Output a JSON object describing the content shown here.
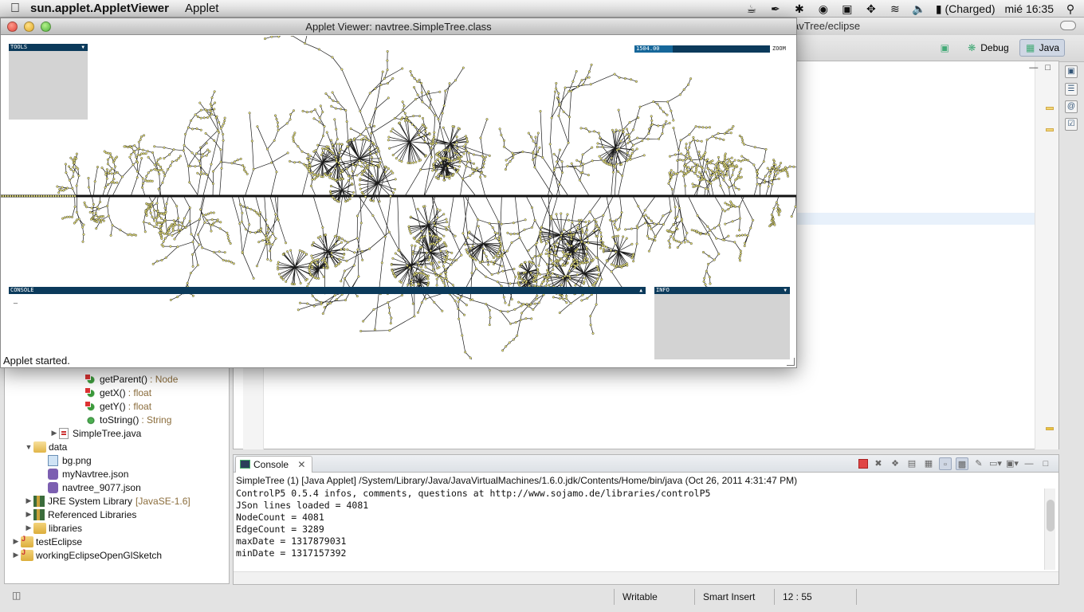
{
  "menubar": {
    "app_name": "sun.applet.AppletViewer",
    "menus": [
      "Applet"
    ],
    "battery": "(Charged)",
    "clock": "mié 16:35"
  },
  "eclipse": {
    "title_fragment": "avTree/eclipse",
    "perspectives": {
      "debug": "Debug",
      "java": "Java"
    }
  },
  "package_explorer": {
    "rows": [
      {
        "label": "getParent()",
        "type": ": Node",
        "icon": "method-icon"
      },
      {
        "label": "getX()",
        "type": ": float",
        "icon": "method-icon"
      },
      {
        "label": "getY()",
        "type": ": float",
        "icon": "method-icon"
      },
      {
        "label": "toString()",
        "type": ": String",
        "icon": "public-method-icon"
      },
      {
        "label": "SimpleTree.java",
        "type": "",
        "icon": "java-file-icon"
      },
      {
        "label": "data",
        "type": "",
        "icon": "folder-icon"
      },
      {
        "label": "bg.png",
        "type": "",
        "icon": "image-file-icon"
      },
      {
        "label": "myNavtree.json",
        "type": "",
        "icon": "json-file-icon"
      },
      {
        "label": "navtree_9077.json",
        "type": "",
        "icon": "json-file-icon"
      },
      {
        "label": "JRE System Library",
        "type": "[JavaSE-1.6]",
        "icon": "library-icon"
      },
      {
        "label": "Referenced Libraries",
        "type": "",
        "icon": "library-icon"
      },
      {
        "label": "libraries",
        "type": "",
        "icon": "folder-icon"
      },
      {
        "label": "testEclipse",
        "type": "",
        "icon": "java-project-icon"
      },
      {
        "label": "workingEclipseOpenGlSketch",
        "type": "",
        "icon": "java-project-icon"
      }
    ]
  },
  "console": {
    "tab_label": "Console",
    "description": "SimpleTree (1) [Java Applet] /System/Library/Java/JavaVirtualMachines/1.6.0.jdk/Contents/Home/bin/java (Oct 26, 2011 4:31:47 PM)",
    "lines": [
      "ControlP5 0.5.4 infos, comments, questions at http://www.sojamo.de/libraries/controlP5",
      "JSon lines loaded = 4081",
      "NodeCount = 4081",
      "EdgeCount = 3289",
      "maxDate = 1317879031",
      "minDate = 1317157392"
    ]
  },
  "statusbar": {
    "writable": "Writable",
    "insert_mode": "Smart Insert",
    "position": "12 : 55"
  },
  "applet": {
    "title": "Applet Viewer: navtree.SimpleTree.class",
    "status": "Applet started.",
    "tools_label": "TOOLS",
    "zoom_value": "1504.00",
    "zoom_fraction": 0.28,
    "zoom_label": "ZOOM",
    "console_label": "CONSOLE",
    "console_cursor": "_",
    "info_label": "INFO"
  }
}
